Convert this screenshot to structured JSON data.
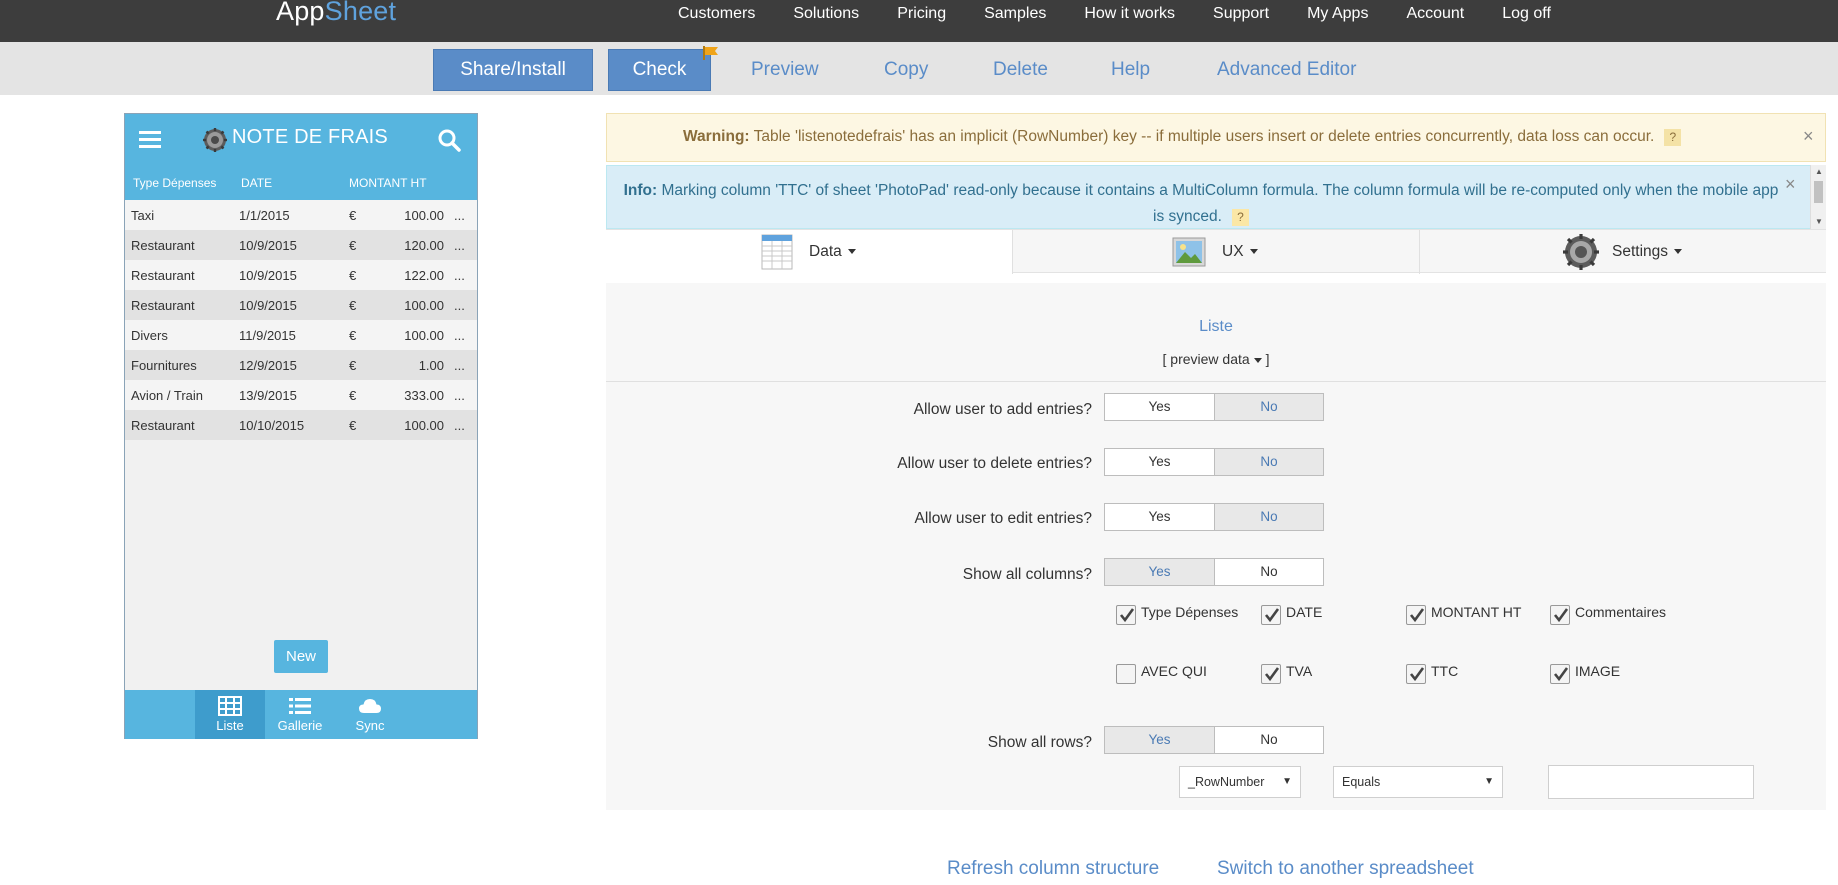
{
  "brand": {
    "app": "App",
    "sheet": "Sheet"
  },
  "topnav": [
    "Customers",
    "Solutions",
    "Pricing",
    "Samples",
    "How it works",
    "Support",
    "My Apps",
    "Account",
    "Log off"
  ],
  "toolbar": {
    "share_install": "Share/Install",
    "check": "Check",
    "preview": "Preview",
    "copy": "Copy",
    "delete": "Delete",
    "help": "Help",
    "advanced_editor": "Advanced Editor"
  },
  "phone": {
    "title": "NOTE DE FRAIS",
    "columns": [
      "Type Dépenses",
      "DATE",
      "MONTANT HT"
    ],
    "rows": [
      {
        "type": "Taxi",
        "date": "1/1/2015",
        "currency": "€",
        "amount": "100.00",
        "more": "..."
      },
      {
        "type": "Restaurant",
        "date": "10/9/2015",
        "currency": "€",
        "amount": "120.00",
        "more": "..."
      },
      {
        "type": "Restaurant",
        "date": "10/9/2015",
        "currency": "€",
        "amount": "122.00",
        "more": "..."
      },
      {
        "type": "Restaurant",
        "date": "10/9/2015",
        "currency": "€",
        "amount": "100.00",
        "more": "..."
      },
      {
        "type": "Divers",
        "date": "11/9/2015",
        "currency": "€",
        "amount": "100.00",
        "more": "..."
      },
      {
        "type": "Fournitures",
        "date": "12/9/2015",
        "currency": "€",
        "amount": "1.00",
        "more": "..."
      },
      {
        "type": "Avion / Train",
        "date": "13/9/2015",
        "currency": "€",
        "amount": "333.00",
        "more": "..."
      },
      {
        "type": "Restaurant",
        "date": "10/10/2015",
        "currency": "€",
        "amount": "100.00",
        "more": "..."
      }
    ],
    "new_button": "New",
    "tabs": [
      "Liste",
      "Gallerie",
      "Sync"
    ]
  },
  "alerts": {
    "warning_label": "Warning:",
    "warning_text": "Table 'listenotedefrais' has an implicit (RowNumber) key -- if multiple users insert or delete entries concurrently, data loss can occur.",
    "info_label": "Info:",
    "info_text": "Marking column 'TTC' of sheet 'PhotoPad' read-only because it contains a MultiColumn formula. The column formula will be re-computed only when the mobile app is synced.",
    "help_mark": "?",
    "close": "×"
  },
  "categories": [
    "Data",
    "UX",
    "Settings"
  ],
  "panel": {
    "view_name": "Liste",
    "preview_data": "[ preview data",
    "questions": [
      {
        "label": "Allow user to add entries?",
        "yes": "Yes",
        "no": "No",
        "selected": "no"
      },
      {
        "label": "Allow user to delete entries?",
        "yes": "Yes",
        "no": "No",
        "selected": "no"
      },
      {
        "label": "Allow user to edit entries?",
        "yes": "Yes",
        "no": "No",
        "selected": "no"
      },
      {
        "label": "Show all columns?",
        "yes": "Yes",
        "no": "No",
        "selected": "yes"
      },
      {
        "label": "Show all rows?",
        "yes": "Yes",
        "no": "No",
        "selected": "yes"
      }
    ],
    "column_checks": [
      {
        "label": "Type Dépenses",
        "checked": true
      },
      {
        "label": "DATE",
        "checked": true
      },
      {
        "label": "MONTANT HT",
        "checked": true
      },
      {
        "label": "Commentaires",
        "checked": true
      },
      {
        "label": "AVEC QUI",
        "checked": false
      },
      {
        "label": "TVA",
        "checked": true
      },
      {
        "label": "TTC",
        "checked": true
      },
      {
        "label": "IMAGE",
        "checked": true
      }
    ],
    "filter": {
      "column": "_RowNumber",
      "operator": "Equals",
      "value": ""
    }
  },
  "bottom_links": {
    "refresh": "Refresh column structure",
    "switch": "Switch to another spreadsheet"
  },
  "colors": {
    "accent": "#5a8cc8",
    "phone": "#57b5df",
    "nav": "#3d3d3d"
  }
}
